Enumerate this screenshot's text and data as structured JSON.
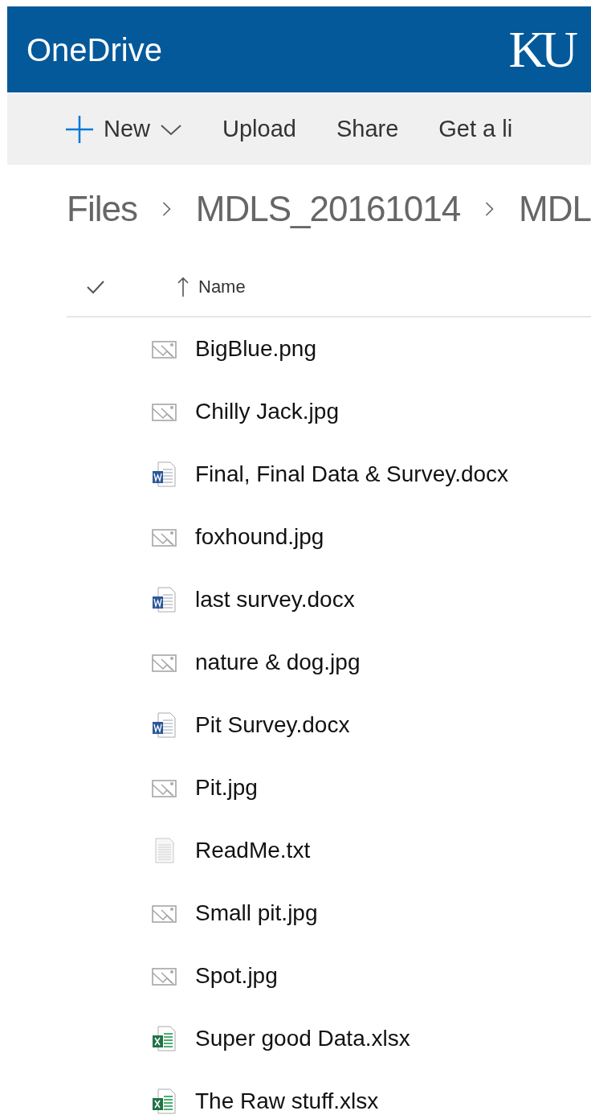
{
  "header": {
    "title": "OneDrive",
    "logo": "KU"
  },
  "toolbar": [
    {
      "kind": "new",
      "label": "New"
    },
    {
      "kind": "plain",
      "label": "Upload"
    },
    {
      "kind": "plain",
      "label": "Share"
    },
    {
      "kind": "plain",
      "label": "Get a li"
    }
  ],
  "breadcrumb": [
    "Files",
    "MDLS_20161014",
    "MDL"
  ],
  "table": {
    "columns": [
      {
        "label": "Name",
        "sorted": true
      }
    ]
  },
  "files": [
    {
      "kind": "image",
      "name": "BigBlue.png"
    },
    {
      "kind": "image",
      "name": "Chilly Jack.jpg"
    },
    {
      "kind": "word",
      "name": "Final, Final Data & Survey.docx"
    },
    {
      "kind": "image",
      "name": "foxhound.jpg"
    },
    {
      "kind": "word",
      "name": "last survey.docx"
    },
    {
      "kind": "image",
      "name": "nature & dog.jpg"
    },
    {
      "kind": "word",
      "name": "Pit Survey.docx"
    },
    {
      "kind": "image",
      "name": "Pit.jpg"
    },
    {
      "kind": "text",
      "name": "ReadMe.txt"
    },
    {
      "kind": "image",
      "name": "Small pit.jpg"
    },
    {
      "kind": "image",
      "name": "Spot.jpg"
    },
    {
      "kind": "excel",
      "name": "Super good Data.xlsx"
    },
    {
      "kind": "excel",
      "name": "The Raw stuff.xlsx"
    }
  ]
}
